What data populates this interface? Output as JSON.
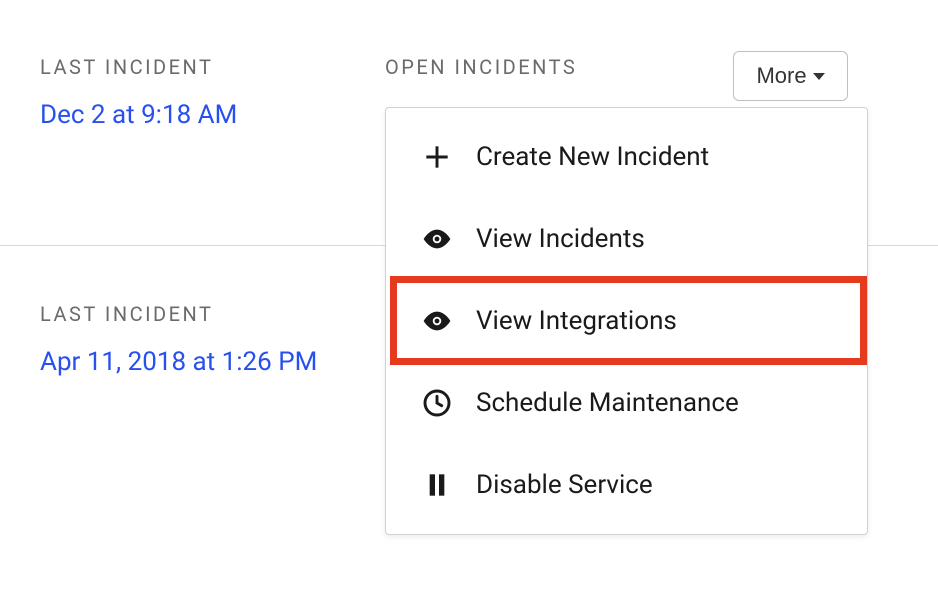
{
  "row1": {
    "last_incident_label": "LAST INCIDENT",
    "last_incident_value": "Dec 2 at 9:18 AM",
    "open_incidents_label": "OPEN INCIDENTS"
  },
  "row2": {
    "last_incident_label": "LAST INCIDENT",
    "last_incident_value": "Apr 11, 2018 at 1:26 PM"
  },
  "more_button": {
    "label": "More"
  },
  "menu": {
    "create": "Create New Incident",
    "view_incidents": "View Incidents",
    "view_integrations": "View Integrations",
    "schedule_maintenance": "Schedule Maintenance",
    "disable_service": "Disable Service"
  }
}
